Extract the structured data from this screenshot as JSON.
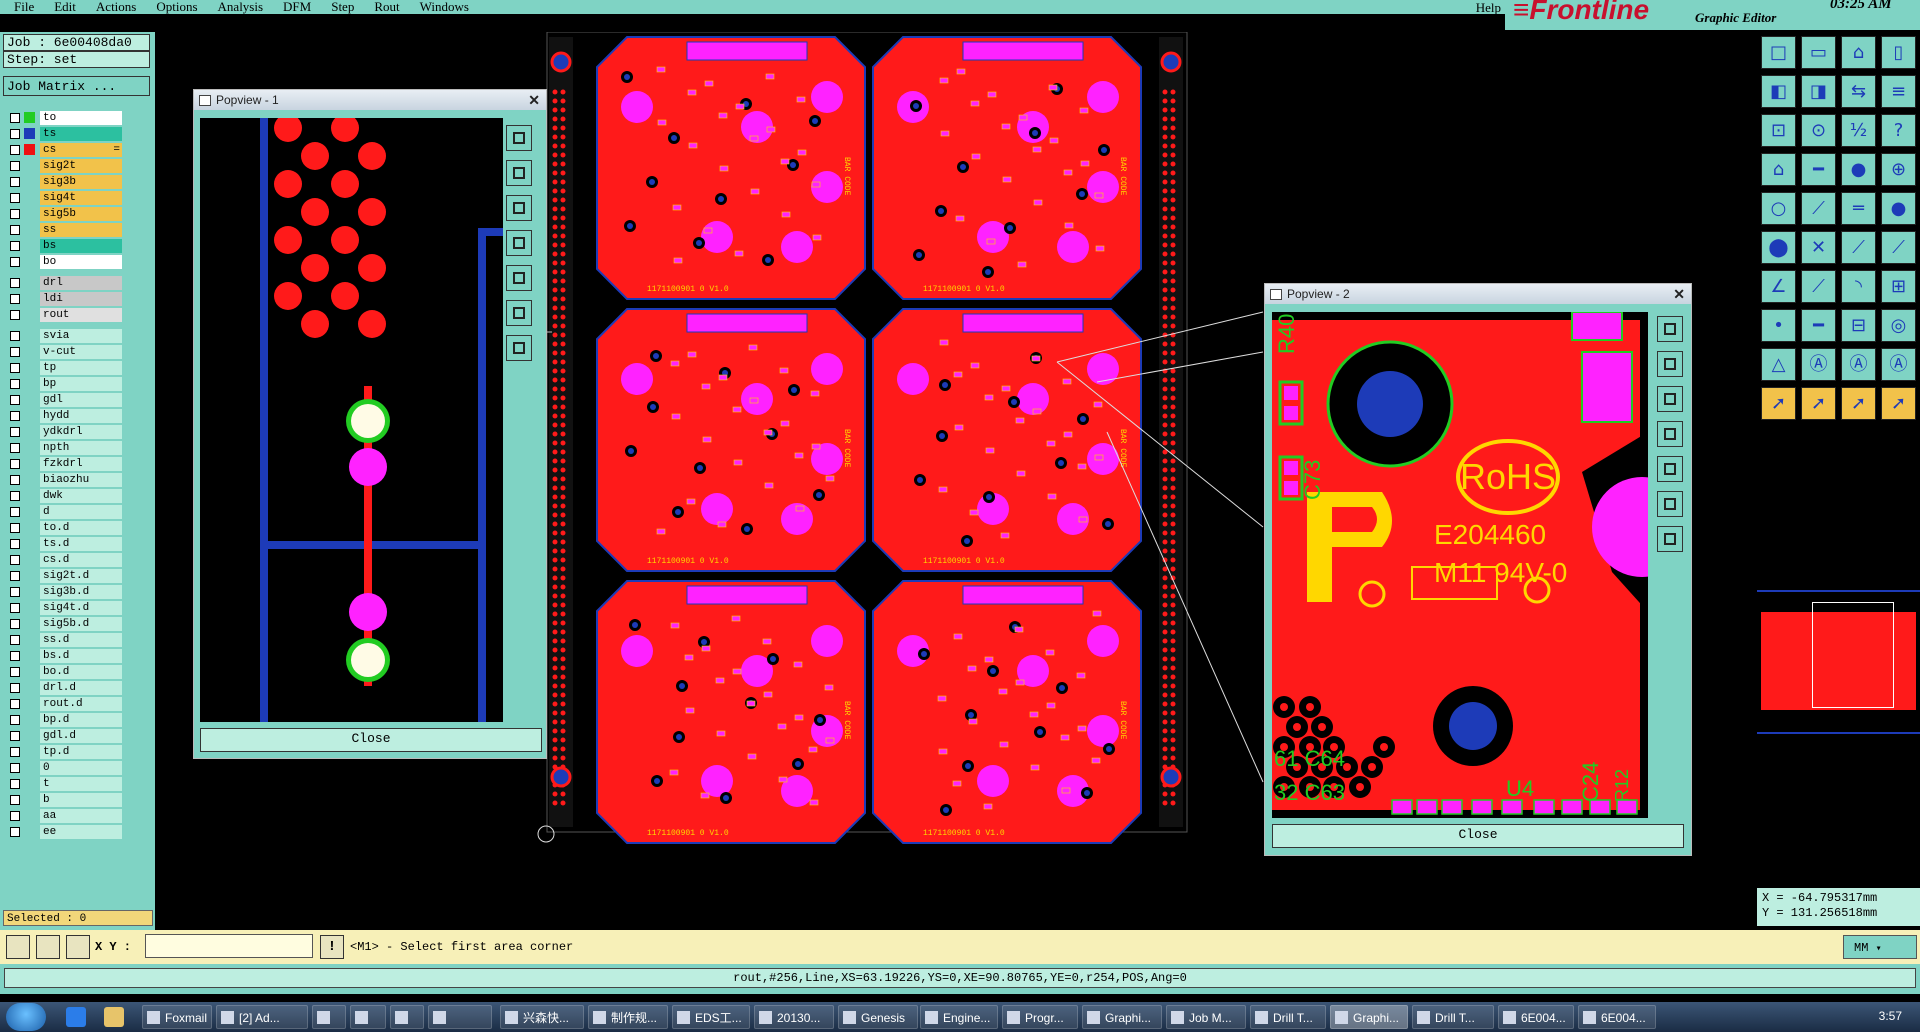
{
  "menu": [
    "File",
    "Edit",
    "Actions",
    "Options",
    "Analysis",
    "DFM",
    "Step",
    "Rout",
    "Windows"
  ],
  "help": "Help",
  "brand": {
    "logo": "Frontline",
    "title": "Graphic Editor",
    "time": "03:25 AM"
  },
  "job": {
    "job_line": "Job : 6e00408da0",
    "step_line": "Step: set",
    "matrix_button": "Job Matrix ..."
  },
  "layers": [
    {
      "name": "to",
      "swatch": "#22cc22",
      "bg": "#ffffff"
    },
    {
      "name": "ts",
      "swatch": "#1d3bb8",
      "bg": "#2cc0a0"
    },
    {
      "name": "cs",
      "swatch": "#ee1111",
      "bg": "#f2c24a",
      "extra": "="
    },
    {
      "name": "sig2t",
      "swatch": "",
      "bg": "#f2c24a"
    },
    {
      "name": "sig3b",
      "swatch": "",
      "bg": "#f2c24a"
    },
    {
      "name": "sig4t",
      "swatch": "",
      "bg": "#f2c24a"
    },
    {
      "name": "sig5b",
      "swatch": "",
      "bg": "#f2c24a"
    },
    {
      "name": "ss",
      "swatch": "",
      "bg": "#f2c24a"
    },
    {
      "name": "bs",
      "swatch": "",
      "bg": "#2cc0a0"
    },
    {
      "name": "bo",
      "swatch": "",
      "bg": "#ffffff"
    },
    {
      "name": "drl",
      "swatch": "",
      "bg": "#c8c8c8",
      "gap": true
    },
    {
      "name": "ldi",
      "swatch": "",
      "bg": "#c8c8c8"
    },
    {
      "name": "rout",
      "swatch": "",
      "bg": "#e0e0e0"
    },
    {
      "name": "svia",
      "swatch": "",
      "bg": "#bdeee0",
      "gap": true
    },
    {
      "name": "v-cut",
      "swatch": "",
      "bg": "#bdeee0"
    },
    {
      "name": "tp",
      "swatch": "",
      "bg": "#bdeee0"
    },
    {
      "name": "bp",
      "swatch": "",
      "bg": "#bdeee0"
    },
    {
      "name": "gdl",
      "swatch": "",
      "bg": "#bdeee0"
    },
    {
      "name": "hydd",
      "swatch": "",
      "bg": "#bdeee0"
    },
    {
      "name": "ydkdrl",
      "swatch": "",
      "bg": "#bdeee0"
    },
    {
      "name": "npth",
      "swatch": "",
      "bg": "#bdeee0"
    },
    {
      "name": "fzkdrl",
      "swatch": "",
      "bg": "#bdeee0"
    },
    {
      "name": "biaozhu",
      "swatch": "",
      "bg": "#bdeee0"
    },
    {
      "name": "dwk",
      "swatch": "",
      "bg": "#bdeee0"
    },
    {
      "name": "d",
      "swatch": "",
      "bg": "#bdeee0"
    },
    {
      "name": "to.d",
      "swatch": "",
      "bg": "#bdeee0"
    },
    {
      "name": "ts.d",
      "swatch": "",
      "bg": "#bdeee0"
    },
    {
      "name": "cs.d",
      "swatch": "",
      "bg": "#bdeee0"
    },
    {
      "name": "sig2t.d",
      "swatch": "",
      "bg": "#bdeee0"
    },
    {
      "name": "sig3b.d",
      "swatch": "",
      "bg": "#bdeee0"
    },
    {
      "name": "sig4t.d",
      "swatch": "",
      "bg": "#bdeee0"
    },
    {
      "name": "sig5b.d",
      "swatch": "",
      "bg": "#bdeee0"
    },
    {
      "name": "ss.d",
      "swatch": "",
      "bg": "#bdeee0"
    },
    {
      "name": "bs.d",
      "swatch": "",
      "bg": "#bdeee0"
    },
    {
      "name": "bo.d",
      "swatch": "",
      "bg": "#bdeee0"
    },
    {
      "name": "drl.d",
      "swatch": "",
      "bg": "#bdeee0"
    },
    {
      "name": "rout.d",
      "swatch": "",
      "bg": "#bdeee0"
    },
    {
      "name": "bp.d",
      "swatch": "",
      "bg": "#bdeee0"
    },
    {
      "name": "gdl.d",
      "swatch": "",
      "bg": "#bdeee0"
    },
    {
      "name": "tp.d",
      "swatch": "",
      "bg": "#bdeee0"
    },
    {
      "name": "0",
      "swatch": "",
      "bg": "#bdeee0"
    },
    {
      "name": "t",
      "swatch": "",
      "bg": "#bdeee0"
    },
    {
      "name": "b",
      "swatch": "",
      "bg": "#bdeee0"
    },
    {
      "name": "aa",
      "swatch": "",
      "bg": "#bdeee0"
    },
    {
      "name": "ee",
      "swatch": "",
      "bg": "#bdeee0"
    }
  ],
  "selected": "Selected : 0",
  "popview1": {
    "title": "Popview - 1",
    "close": "Close"
  },
  "popview2": {
    "title": "Popview - 2",
    "close": "Close",
    "labels": {
      "r40": "R40",
      "c73": "C73",
      "rohs": "RoHS",
      "cert1": "E204460",
      "cert2": "M11 94V-0",
      "c64": "61 C64",
      "c63": "32 C63",
      "u4": "U4",
      "c24": "C24",
      "r12": "R12"
    }
  },
  "board_text": {
    "pn": "1171100901 0 V1.0",
    "barcode": "BAR CODE"
  },
  "coords": {
    "x": "X = -64.795317mm",
    "y": "Y = 131.256518mm"
  },
  "cmd": {
    "xy_label": "X Y :",
    "xy_value": "",
    "prompt": "<M1> - Select first area corner",
    "units": "MM"
  },
  "status": "rout,#256,Line,XS=63.19226,YS=0,XE=90.80765,YE=0,r254,POS,Ang=0",
  "taskbar": {
    "items": [
      "Foxmail",
      "[2] Ad...",
      "",
      "",
      "",
      "",
      "兴森快...",
      "制作规...",
      "EDS工...",
      "20130...",
      "Genesis",
      "Engine...",
      "Progr...",
      "Graphi...",
      "Job M...",
      "Drill T...",
      "Graphi...",
      "Drill T...",
      "6E004...",
      "6E004..."
    ],
    "clock": "3:57"
  },
  "colors": {
    "accent": "#7fd3c4",
    "copper": "#ff1a1a",
    "pad": "#ff22ff",
    "trace": "#1d3bb8",
    "silk": "#ffd700",
    "outline": "#22cc22"
  }
}
